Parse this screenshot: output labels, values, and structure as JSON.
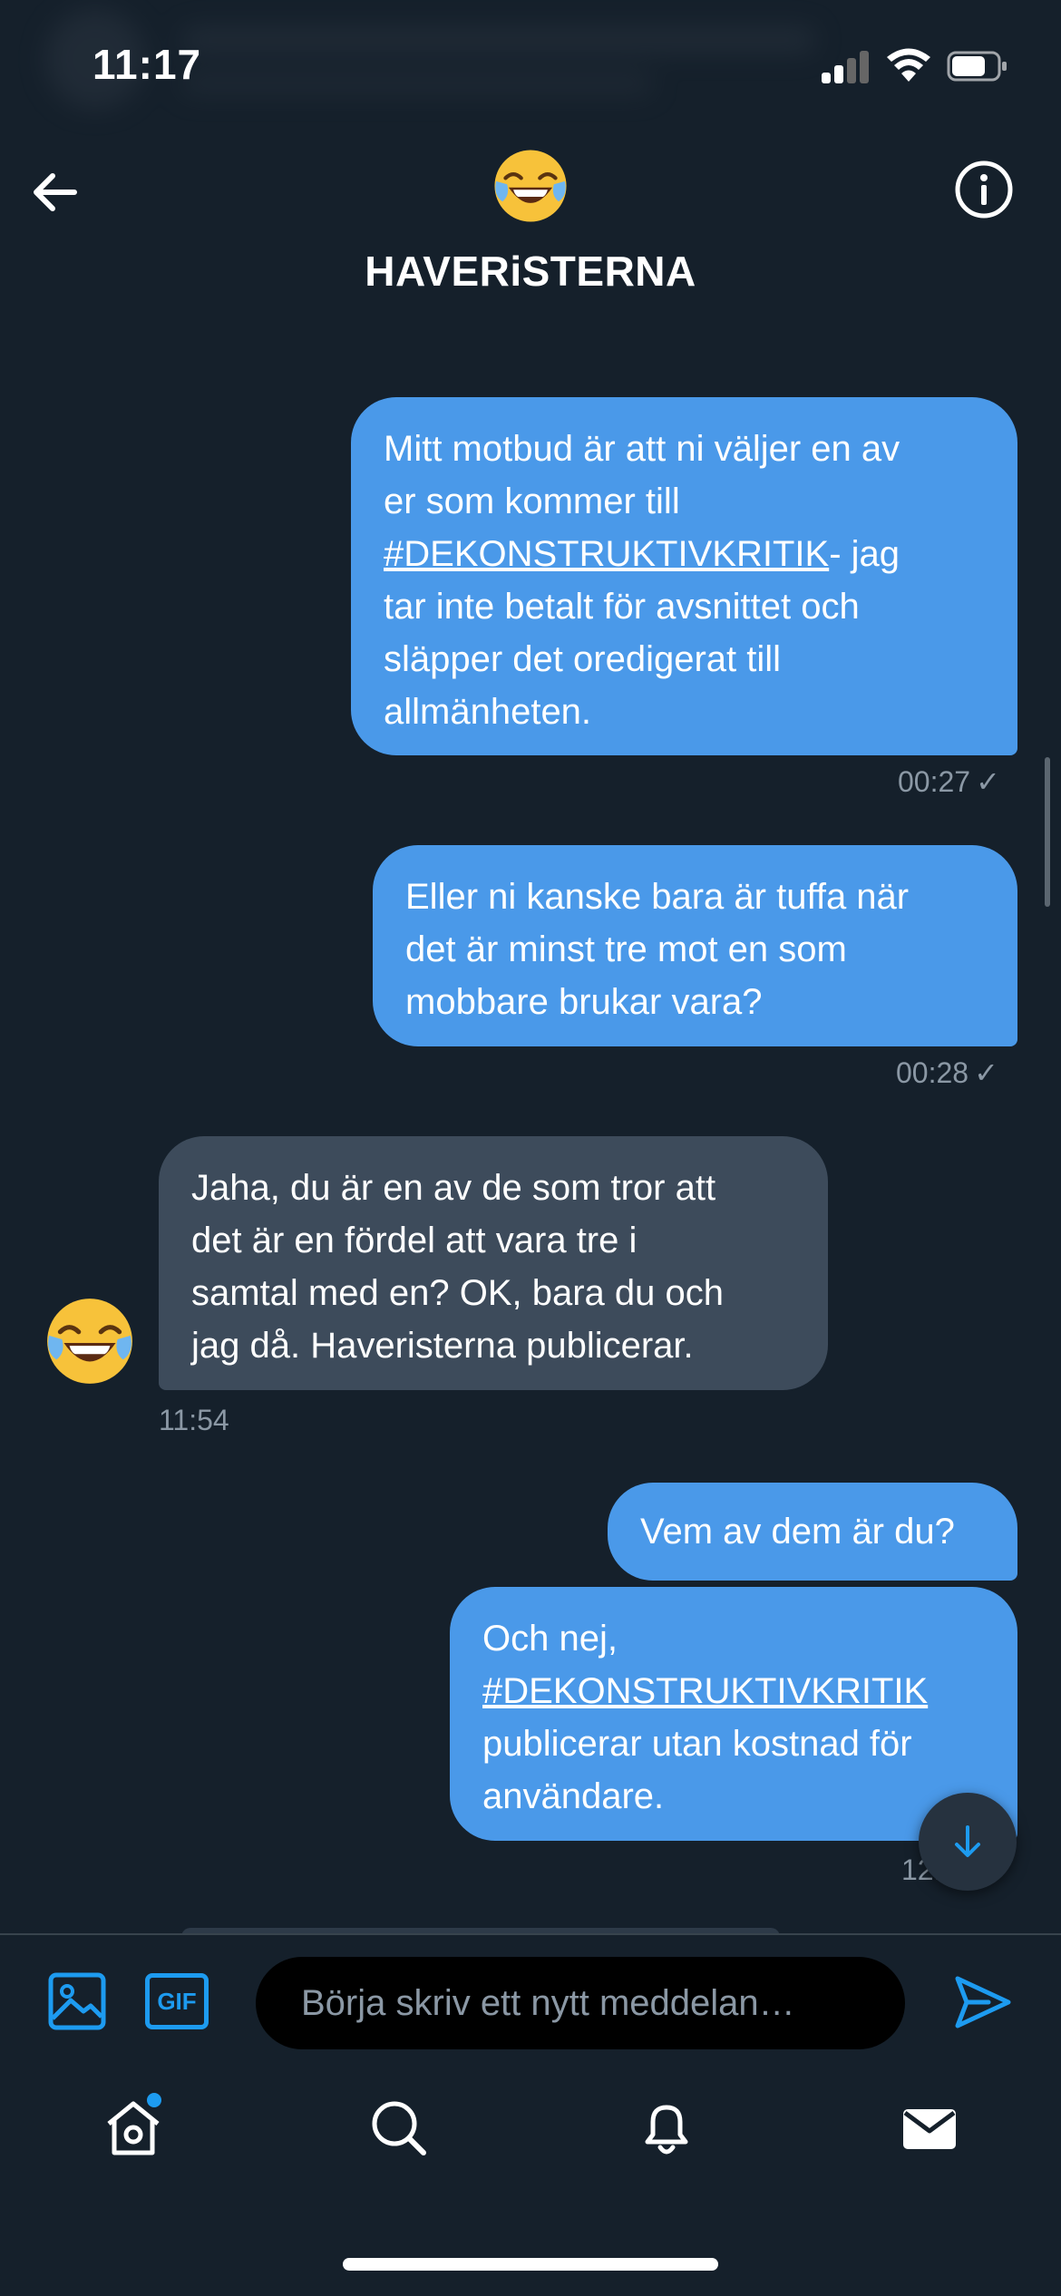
{
  "status_bar": {
    "time": "11:17"
  },
  "header": {
    "title": "HAVERiSTERNA",
    "avatar_icon": "face-with-tears-of-joy",
    "back_icon": "arrow-left-icon",
    "info_icon": "info-icon"
  },
  "messages": [
    {
      "direction": "outgoing",
      "lines": [
        "Mitt motbud är att ni väljer en av",
        "er som kommer till"
      ],
      "hashtag": "#DEKONSTRUKTIVKRITIK",
      "after_hashtag": "- jag",
      "rest": [
        "tar inte betalt för avsnittet och",
        "släpper det oredigerat till",
        "allmänheten."
      ],
      "time": "00:27"
    },
    {
      "direction": "outgoing",
      "lines": [
        "Eller ni kanske bara är tuffa när",
        "det är minst tre mot en som",
        "mobbare brukar vara?"
      ],
      "time": "00:28"
    },
    {
      "direction": "incoming",
      "lines": [
        "Jaha, du är en av de som tror att",
        "det är en fördel att vara tre i",
        "samtal med en? OK, bara du och",
        "jag då. Haveristerna publicerar."
      ],
      "time": "11:54"
    },
    {
      "direction": "outgoing",
      "lines": [
        "Vem av dem är du?"
      ]
    },
    {
      "direction": "outgoing",
      "first": "Och nej,",
      "hashtag": "#DEKONSTRUKTIVKRITIK",
      "rest": [
        "publicerar utan kostnad för",
        "användare."
      ],
      "time": "12:"
    }
  ],
  "composer": {
    "placeholder": "Börja skriv ett nytt meddelan…",
    "gif_label": "GIF"
  },
  "tabs": [
    "home-icon",
    "search-icon",
    "notifications-icon",
    "messages-icon"
  ],
  "colors": {
    "background": "#15202b",
    "outgoing": "#4a99e9",
    "incoming": "#3d4b5b",
    "accent": "#1d9bf0"
  }
}
